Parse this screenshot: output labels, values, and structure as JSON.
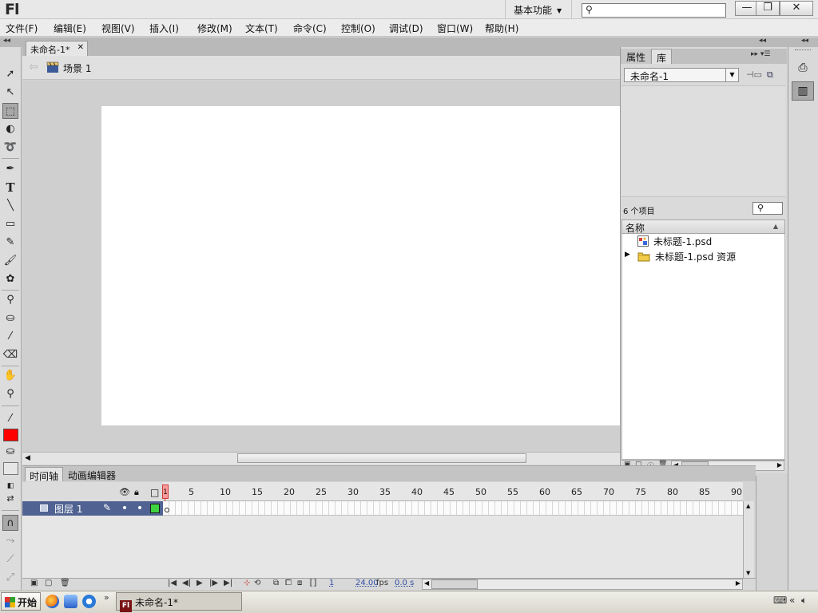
{
  "app": {
    "logo": "Fl",
    "workspace": "基本功能",
    "search_placeholder": ""
  },
  "window_buttons": {
    "minimize": "—",
    "restore": "❐",
    "close": "✕"
  },
  "menu": [
    "文件(F)",
    "编辑(E)",
    "视图(V)",
    "插入(I)",
    "修改(M)",
    "文本(T)",
    "命令(C)",
    "控制(O)",
    "调试(D)",
    "窗口(W)",
    "帮助(H)"
  ],
  "document": {
    "tab_title": "未命名-1*",
    "scene": "场景 1"
  },
  "library": {
    "tabs": [
      "属性",
      "库"
    ],
    "document_select": "未命名-1",
    "item_count": "6 个项目",
    "column_name": "名称",
    "items": [
      {
        "label": "未标题-1.psd",
        "icon": "bitmap-icon"
      },
      {
        "label": "未标题-1.psd 资源",
        "icon": "folder-icon"
      }
    ]
  },
  "timeline": {
    "tabs": [
      "时间轴",
      "动画编辑器"
    ],
    "ruler": [
      "1",
      "5",
      "10",
      "15",
      "20",
      "25",
      "30",
      "35",
      "40",
      "45",
      "50",
      "55",
      "60",
      "65",
      "70",
      "75",
      "80",
      "85",
      "90"
    ],
    "layer_name": "图层 1",
    "current_frame": "1",
    "fps": "24.00",
    "fps_unit": "fps",
    "elapsed": "0.0 s"
  },
  "taskbar": {
    "start": "开始",
    "task": "未命名-1*"
  },
  "colors": {
    "fill_swatch": "#ff0000",
    "layer_outline": "#3fd43f",
    "layer_selected": "#4f6291"
  }
}
